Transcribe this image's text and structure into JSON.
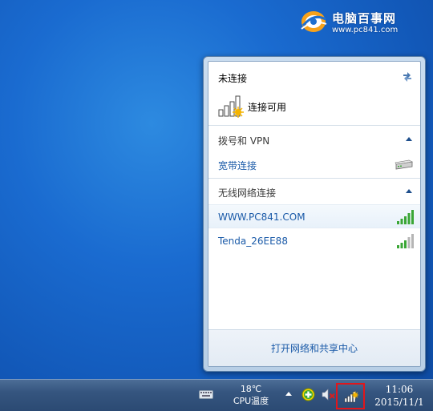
{
  "watermark": {
    "title": "电脑百事网",
    "url": "www.pc841.com"
  },
  "flyout": {
    "status_title": "未连接",
    "available_text": "连接可用",
    "dialup_group": {
      "label": "拨号和 VPN",
      "items": [
        {
          "label": "宽带连接",
          "icon": "modem-icon"
        }
      ]
    },
    "wireless_group": {
      "label": "无线网络连接",
      "items": [
        {
          "label": "WWW.PC841.COM",
          "icon": "wifi-signal-icon",
          "signal_bars": 5
        },
        {
          "label": "Tenda_26EE88",
          "icon": "wifi-signal-icon",
          "signal_bars": 3
        }
      ]
    },
    "footer_link": "打开网络和共享中心"
  },
  "taskbar": {
    "temp_value": "18℃",
    "temp_label": "CPU温度",
    "time": "11:06",
    "date": "2015/11/1"
  },
  "colors": {
    "link": "#1a5aa8",
    "highlight_border": "#e0161c",
    "signal_green": "#3aa635",
    "signal_gray": "#b5b5b5"
  }
}
